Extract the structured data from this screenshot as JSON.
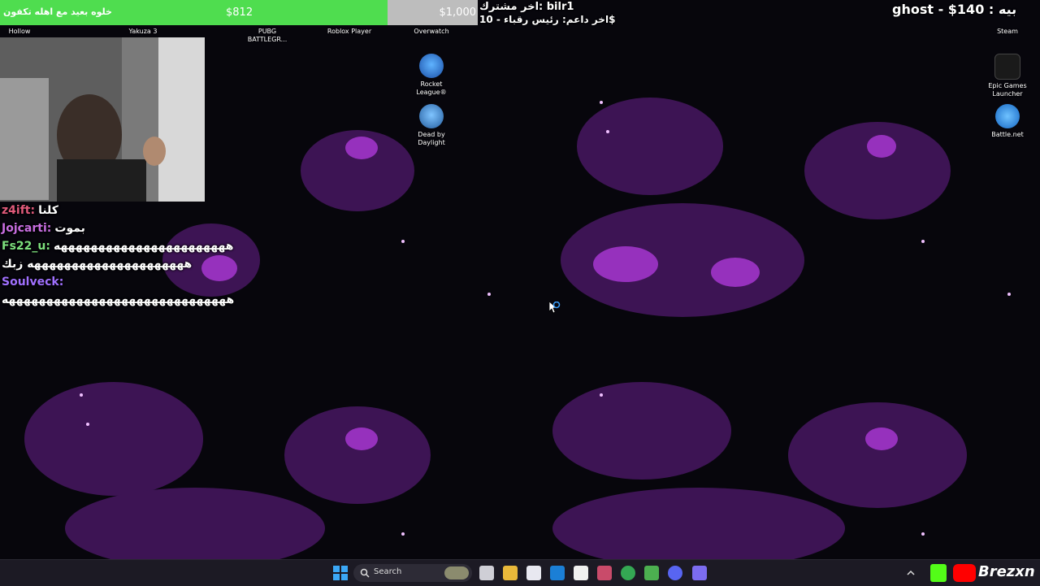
{
  "donation": {
    "message": "خلوه بعيد مع اهله تكفون",
    "current": "$812",
    "goal": "$1,000",
    "progress": 0.812,
    "fill_color": "#4fdd4f"
  },
  "latest": {
    "subscriber": "اخر مشترك: bilr1",
    "supporter": "اخر داعم: رئيس رقباء - 10$"
  },
  "top_right_text": "ghost - $140 : بيه",
  "desktop_icons": [
    {
      "label": "Hollow",
      "name": "hollow-icon"
    },
    {
      "label": "Yakuza 3",
      "name": "yakuza-icon"
    },
    {
      "label": "PUBG BATTLEGR...",
      "name": "pubg-icon"
    },
    {
      "label": "Roblox Player",
      "name": "roblox-icon"
    },
    {
      "label": "Overwatch",
      "name": "overwatch-icon"
    },
    {
      "label": "Rocket League®",
      "name": "rocket-league-icon"
    },
    {
      "label": "Dead by Daylight",
      "name": "dead-by-daylight-icon"
    },
    {
      "label": "Steam",
      "name": "steam-icon"
    },
    {
      "label": "Epic Games Launcher",
      "name": "epic-games-icon"
    },
    {
      "label": "Battle.net",
      "name": "battlenet-icon"
    }
  ],
  "chat": [
    {
      "user": "z4ift:",
      "text": "كلنا",
      "color": "#e05a7a"
    },
    {
      "user": "Jojcarti:",
      "text": "بموت",
      "color": "#c86ee0"
    },
    {
      "user": "Fs22_u:",
      "text": "هههههههههههههههههههههههه",
      "color": "#7de07d"
    },
    {
      "user": "",
      "text": "هههههههههههههههههههههه زبك",
      "color": "#ffffff"
    },
    {
      "user": "Soulveck:",
      "text": "",
      "color": "#a070ff"
    },
    {
      "user": "",
      "text": "ههههههههههههههههههههههههههههههه",
      "color": "#ffffff"
    }
  ],
  "taskbar": {
    "search_placeholder": "Search",
    "brand": "Brezxn"
  },
  "colors": {
    "taskbar": "#1c1a24",
    "wallpaper": "#07060c",
    "nebula": "#8a2fb8"
  }
}
